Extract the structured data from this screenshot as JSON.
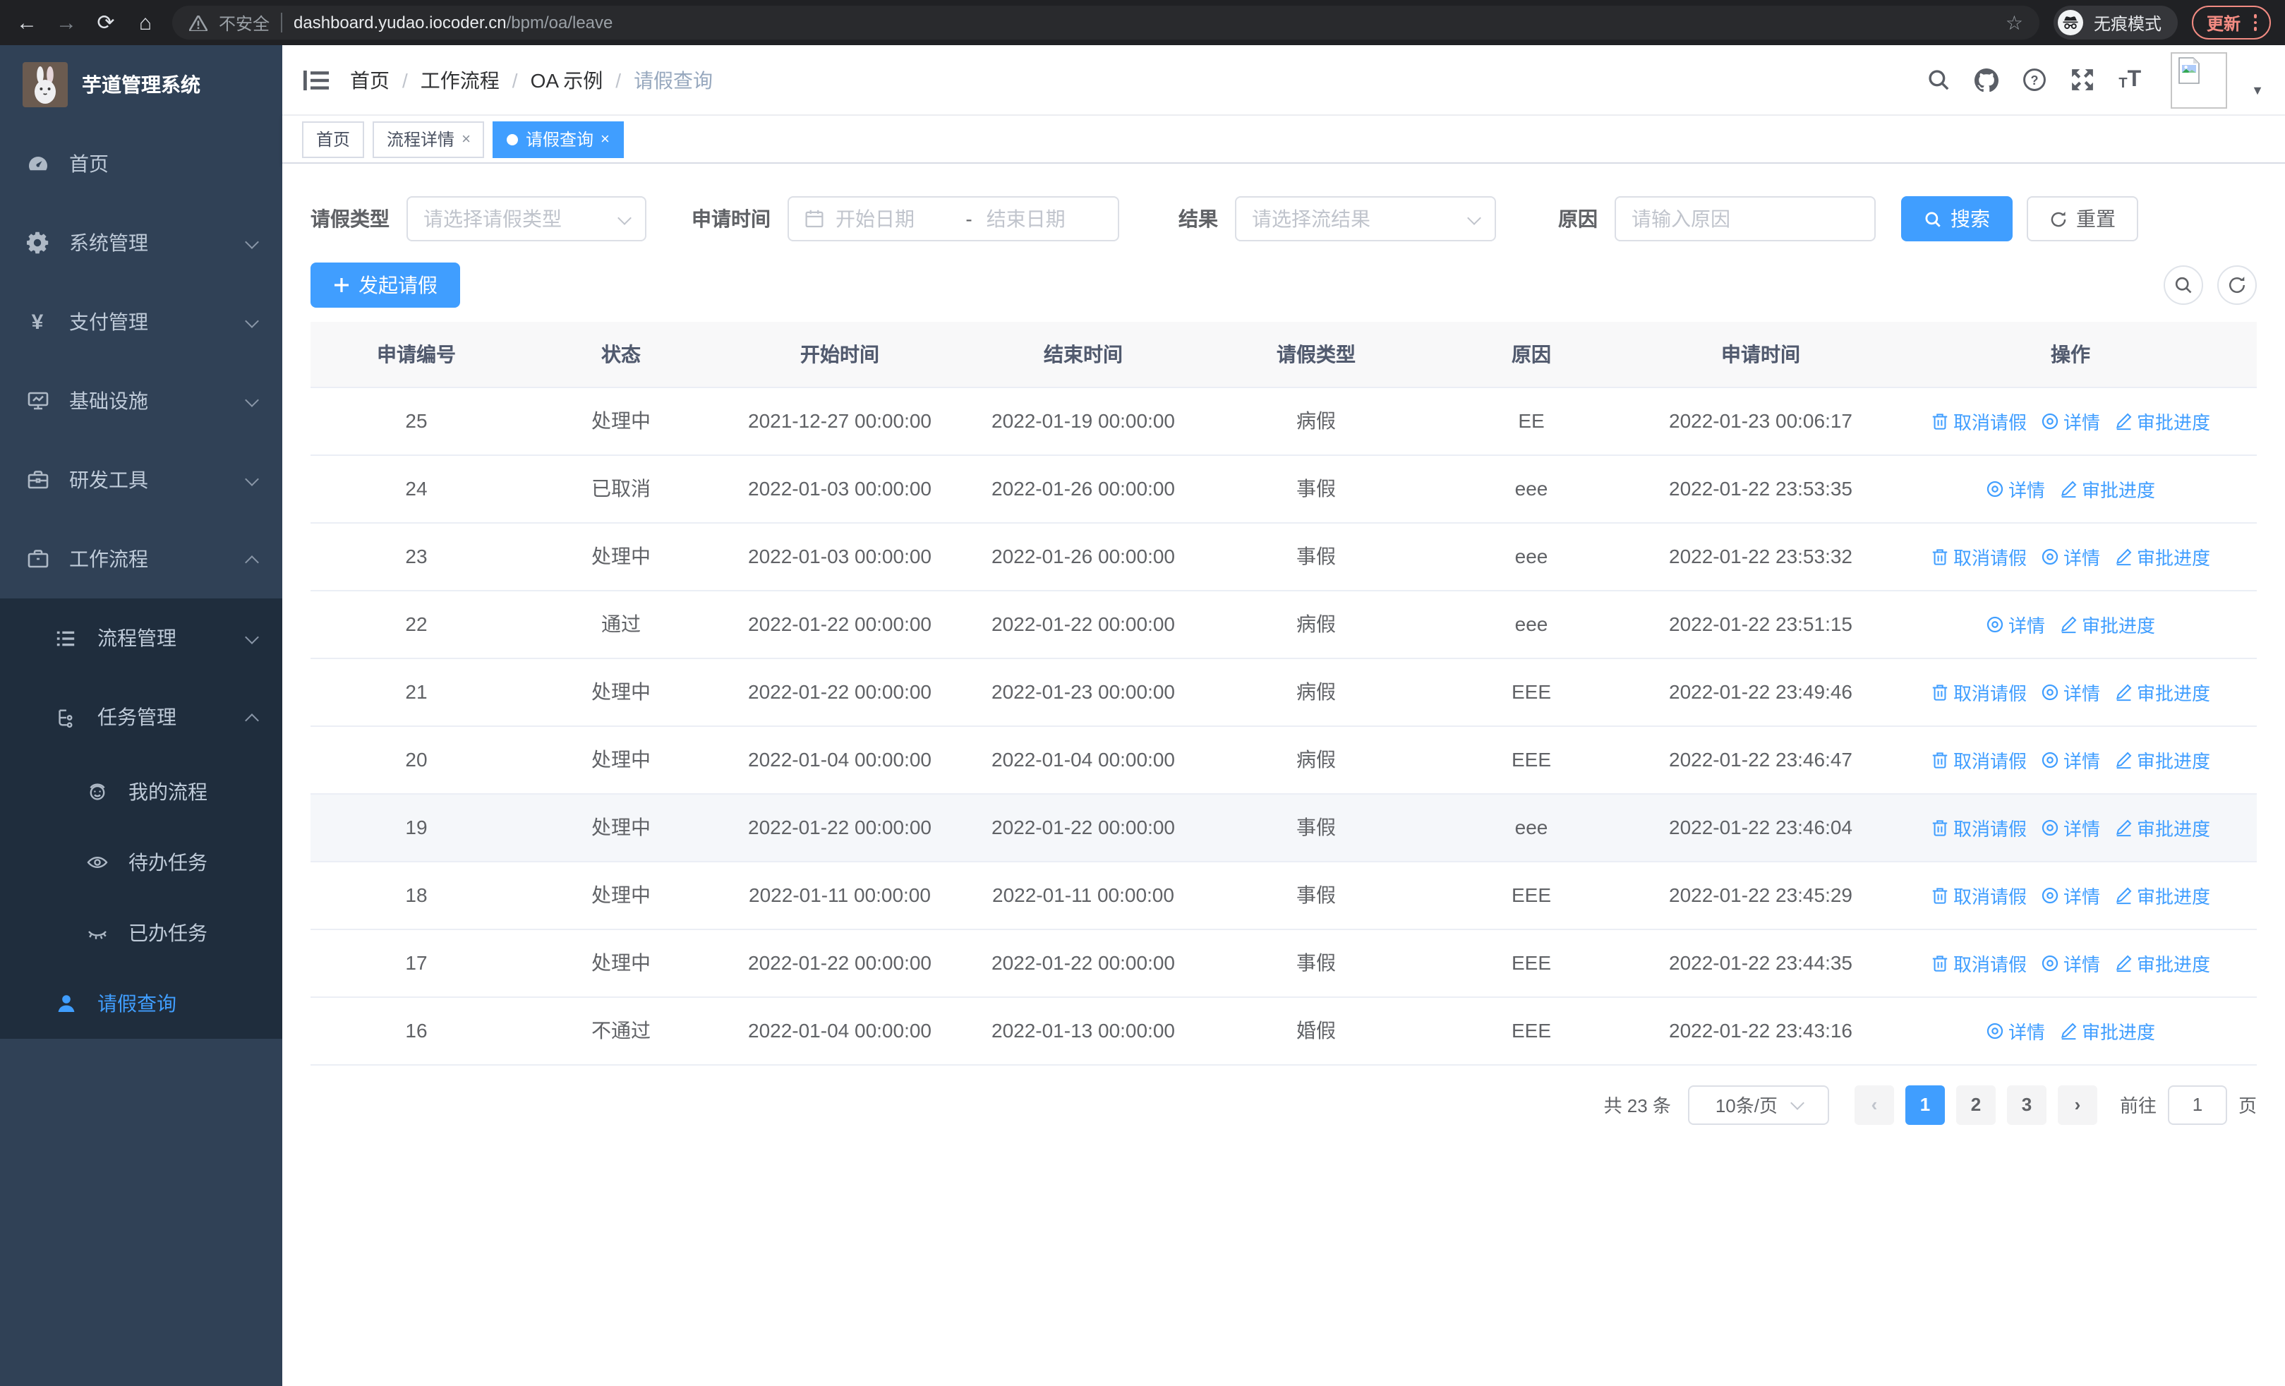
{
  "browser": {
    "security_label": "不安全",
    "url_host": "dashboard.yudao.iocoder.cn",
    "url_path": "/bpm/oa/leave",
    "incognito_label": "无痕模式",
    "update_label": "更新"
  },
  "sidebar": {
    "title": "芋道管理系统",
    "items": [
      {
        "label": "首页"
      },
      {
        "label": "系统管理"
      },
      {
        "label": "支付管理"
      },
      {
        "label": "基础设施"
      },
      {
        "label": "研发工具"
      },
      {
        "label": "工作流程"
      },
      {
        "label": "流程管理"
      },
      {
        "label": "任务管理"
      },
      {
        "label": "我的流程"
      },
      {
        "label": "待办任务"
      },
      {
        "label": "已办任务"
      },
      {
        "label": "请假查询"
      }
    ]
  },
  "breadcrumb": {
    "items": [
      "首页",
      "工作流程",
      "OA 示例",
      "请假查询"
    ]
  },
  "tabs": [
    {
      "label": "首页"
    },
    {
      "label": "流程详情"
    },
    {
      "label": "请假查询"
    }
  ],
  "filters": {
    "leave_type_label": "请假类型",
    "leave_type_placeholder": "请选择请假类型",
    "apply_time_label": "申请时间",
    "start_placeholder": "开始日期",
    "range_separator": "-",
    "end_placeholder": "结束日期",
    "result_label": "结果",
    "result_placeholder": "请选择流结果",
    "reason_label": "原因",
    "reason_placeholder": "请输入原因",
    "search_label": "搜索",
    "reset_label": "重置"
  },
  "toolbar": {
    "create_label": "发起请假"
  },
  "table": {
    "headers": [
      "申请编号",
      "状态",
      "开始时间",
      "结束时间",
      "请假类型",
      "原因",
      "申请时间",
      "操作"
    ],
    "action_labels": {
      "cancel": "取消请假",
      "detail": "详情",
      "progress": "审批进度"
    },
    "rows": [
      {
        "id": "25",
        "status": "处理中",
        "start": "2021-12-27 00:00:00",
        "end": "2022-01-19 00:00:00",
        "type": "病假",
        "reason": "EE",
        "applied": "2022-01-23 00:06:17",
        "actions": [
          "cancel",
          "detail",
          "progress"
        ],
        "highlight": false
      },
      {
        "id": "24",
        "status": "已取消",
        "start": "2022-01-03 00:00:00",
        "end": "2022-01-26 00:00:00",
        "type": "事假",
        "reason": "eee",
        "applied": "2022-01-22 23:53:35",
        "actions": [
          "detail",
          "progress"
        ],
        "highlight": false
      },
      {
        "id": "23",
        "status": "处理中",
        "start": "2022-01-03 00:00:00",
        "end": "2022-01-26 00:00:00",
        "type": "事假",
        "reason": "eee",
        "applied": "2022-01-22 23:53:32",
        "actions": [
          "cancel",
          "detail",
          "progress"
        ],
        "highlight": false
      },
      {
        "id": "22",
        "status": "通过",
        "start": "2022-01-22 00:00:00",
        "end": "2022-01-22 00:00:00",
        "type": "病假",
        "reason": "eee",
        "applied": "2022-01-22 23:51:15",
        "actions": [
          "detail",
          "progress"
        ],
        "highlight": false
      },
      {
        "id": "21",
        "status": "处理中",
        "start": "2022-01-22 00:00:00",
        "end": "2022-01-23 00:00:00",
        "type": "病假",
        "reason": "EEE",
        "applied": "2022-01-22 23:49:46",
        "actions": [
          "cancel",
          "detail",
          "progress"
        ],
        "highlight": false
      },
      {
        "id": "20",
        "status": "处理中",
        "start": "2022-01-04 00:00:00",
        "end": "2022-01-04 00:00:00",
        "type": "病假",
        "reason": "EEE",
        "applied": "2022-01-22 23:46:47",
        "actions": [
          "cancel",
          "detail",
          "progress"
        ],
        "highlight": false
      },
      {
        "id": "19",
        "status": "处理中",
        "start": "2022-01-22 00:00:00",
        "end": "2022-01-22 00:00:00",
        "type": "事假",
        "reason": "eee",
        "applied": "2022-01-22 23:46:04",
        "actions": [
          "cancel",
          "detail",
          "progress"
        ],
        "highlight": true
      },
      {
        "id": "18",
        "status": "处理中",
        "start": "2022-01-11 00:00:00",
        "end": "2022-01-11 00:00:00",
        "type": "事假",
        "reason": "EEE",
        "applied": "2022-01-22 23:45:29",
        "actions": [
          "cancel",
          "detail",
          "progress"
        ],
        "highlight": false
      },
      {
        "id": "17",
        "status": "处理中",
        "start": "2022-01-22 00:00:00",
        "end": "2022-01-22 00:00:00",
        "type": "事假",
        "reason": "EEE",
        "applied": "2022-01-22 23:44:35",
        "actions": [
          "cancel",
          "detail",
          "progress"
        ],
        "highlight": false
      },
      {
        "id": "16",
        "status": "不通过",
        "start": "2022-01-04 00:00:00",
        "end": "2022-01-13 00:00:00",
        "type": "婚假",
        "reason": "EEE",
        "applied": "2022-01-22 23:43:16",
        "actions": [
          "detail",
          "progress"
        ],
        "highlight": false
      }
    ]
  },
  "pagination": {
    "total_label": "共 23 条",
    "page_size_label": "10条/页",
    "pages": [
      "1",
      "2",
      "3"
    ],
    "current_page": "1",
    "goto_label": "前往",
    "goto_value": "1",
    "goto_suffix": "页"
  },
  "colors": {
    "primary": "#409eff",
    "sidebar_bg": "#304156",
    "submenu_bg": "#1f2d3d"
  }
}
